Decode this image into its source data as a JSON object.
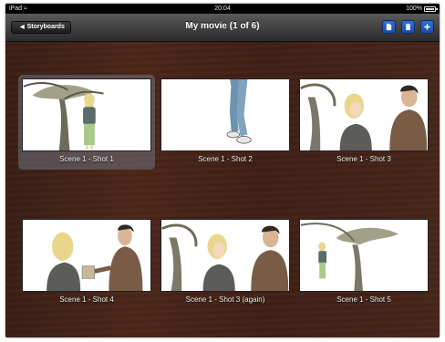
{
  "status_bar": {
    "device": "iPad",
    "time": "20:04",
    "battery": "100%"
  },
  "nav": {
    "back_label": "Storyboards",
    "title": "My movie (1 of 6)",
    "icons": [
      "document-icon",
      "trash-icon",
      "add-icon"
    ]
  },
  "shots": [
    {
      "caption": "Scene 1 - Shot 1",
      "selected": true,
      "art": "tree-woman"
    },
    {
      "caption": "Scene 1 - Shot 2",
      "selected": false,
      "art": "legs-walking"
    },
    {
      "caption": "Scene 1 - Shot 3",
      "selected": false,
      "art": "tree-woman-man"
    },
    {
      "caption": "Scene 1 - Shot 4",
      "selected": false,
      "art": "woman-man-handoff"
    },
    {
      "caption": "Scene 1 - Shot 3 (again)",
      "selected": false,
      "art": "tree-woman-man"
    },
    {
      "caption": "Scene 1 - Shot 5",
      "selected": false,
      "art": "tree-woman-small"
    }
  ],
  "colors": {
    "wood": "#4b2618",
    "nav_blue": "#2f6fd4",
    "selection": "#7882a0"
  }
}
